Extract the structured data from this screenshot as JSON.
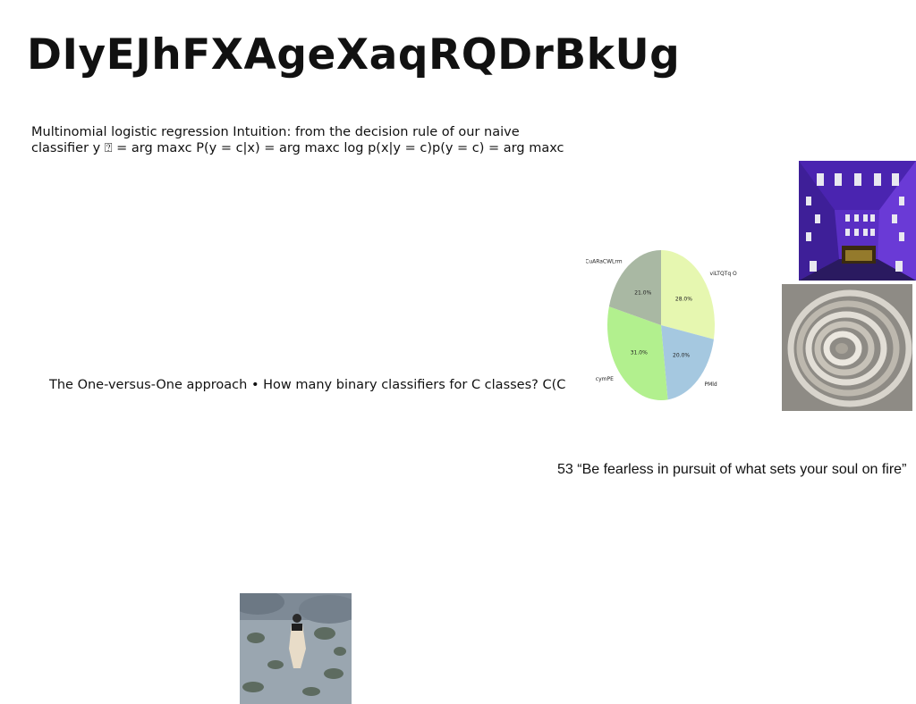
{
  "slide": {
    "title": "DIyEJhFXAgeXaqRQDrBkUg",
    "paragraph_lines": [
      "Multinomial logistic regression Intuition: from the decision rule of our naive",
      "classifier y ⍰ = arg maxc P(y = c|x) = arg maxc log p(x|y = c)p(y = c) = arg maxc"
    ],
    "ovo_text": "The One-versus-One approach • How many binary classifiers for C classes? C(C",
    "quote": "53 “Be fearless in pursuit of what sets your soul on fire”"
  },
  "chart_data": {
    "type": "pie",
    "labels": [
      "viLTQTq O",
      "PMld",
      "cymPE",
      "CuARaCWLrm"
    ],
    "values": [
      28.0,
      20.0,
      31.0,
      21.0
    ],
    "value_labels": [
      "28.0%",
      "20.0%",
      "31.0%",
      "21.0%"
    ],
    "colors": [
      "#e6f7b0",
      "#a5c8e0",
      "#b2f08e",
      "#a9b8a3"
    ],
    "start": "top",
    "direction": "clockwise"
  }
}
